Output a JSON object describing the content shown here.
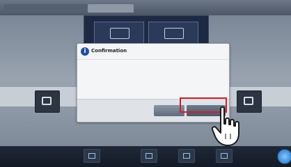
{
  "titlebar": {
    "tab1": "",
    "tab2": ""
  },
  "dialog": {
    "title": "Confirmation",
    "message": "",
    "no_label": "",
    "yes_label": ""
  },
  "icons": {
    "info": "info-icon",
    "pointer": "pointing-hand-icon"
  },
  "colors": {
    "highlight": "#d0202a",
    "dialog_title_icon": "#1f4f9c",
    "toolbar_bg": "#1f2838"
  }
}
